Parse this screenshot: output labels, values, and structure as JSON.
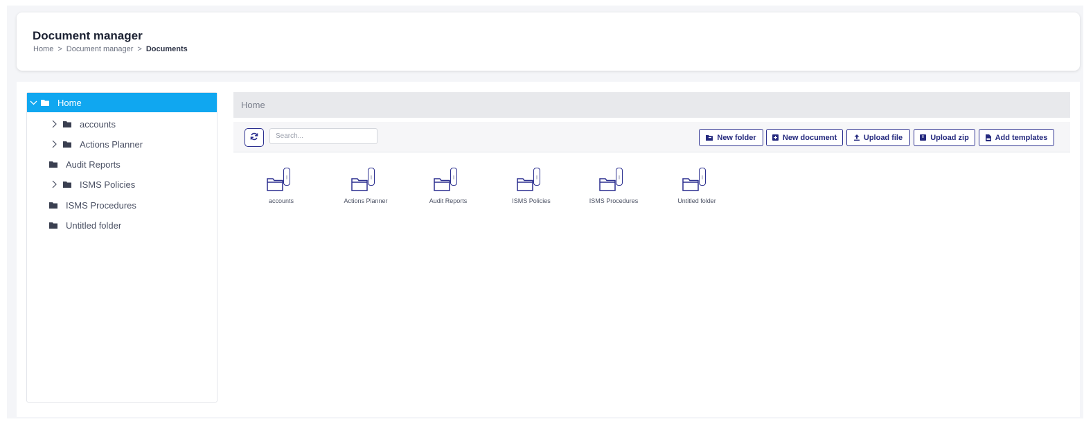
{
  "header": {
    "title": "Document manager",
    "breadcrumb": [
      "Home",
      "Document manager",
      "Documents"
    ]
  },
  "tree": {
    "root": "Home",
    "items": [
      {
        "label": "accounts",
        "expandable": true
      },
      {
        "label": "Actions Planner",
        "expandable": true
      },
      {
        "label": "Audit Reports",
        "expandable": false
      },
      {
        "label": "ISMS Policies",
        "expandable": true
      },
      {
        "label": "ISMS Procedures",
        "expandable": false
      },
      {
        "label": "Untitled folder",
        "expandable": false
      }
    ]
  },
  "path_bar": "Home",
  "toolbar": {
    "search_placeholder": "Search...",
    "new_folder": "New folder",
    "new_document": "New document",
    "upload_file": "Upload file",
    "upload_zip": "Upload zip",
    "add_templates": "Add templates"
  },
  "folders": [
    {
      "name": "accounts"
    },
    {
      "name": "Actions Planner"
    },
    {
      "name": "Audit Reports"
    },
    {
      "name": "ISMS Policies"
    },
    {
      "name": "ISMS Procedures"
    },
    {
      "name": "Untitled folder"
    }
  ],
  "colors": {
    "accent": "#10a7f0",
    "button_border": "#2b2f8f",
    "path_bar_bg": "#e8e9ec"
  }
}
